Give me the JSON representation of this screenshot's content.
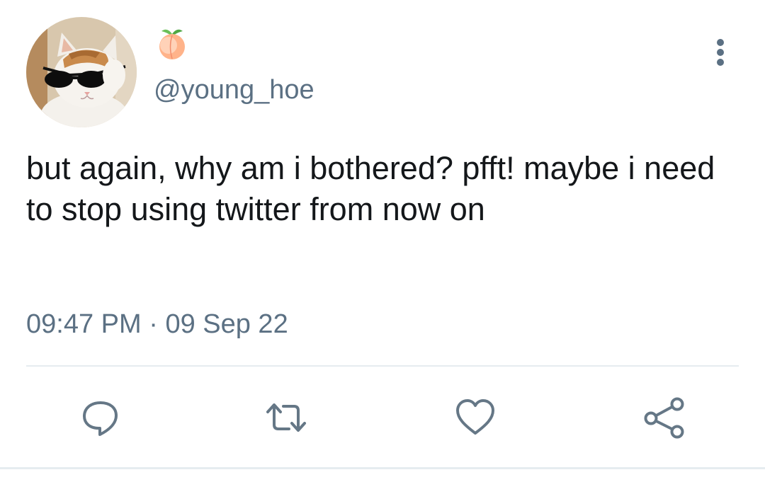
{
  "tweet": {
    "display_name_emoji": "peach",
    "handle": "@young_hoe",
    "text": "but again, why am i bothered? pfft! maybe i need to stop using twitter from now on",
    "time": "09:47 PM",
    "separator": "·",
    "date": "09 Sep 22"
  },
  "icons": {
    "avatar": "cat-with-sunglasses-avatar",
    "more": "more-vertical-icon",
    "reply": "reply-icon",
    "retweet": "retweet-icon",
    "like": "heart-icon",
    "share": "share-icon"
  },
  "colors": {
    "text": "#14171a",
    "secondary": "#5b7083",
    "icon": "#657786",
    "divider": "#e6ecf0"
  }
}
